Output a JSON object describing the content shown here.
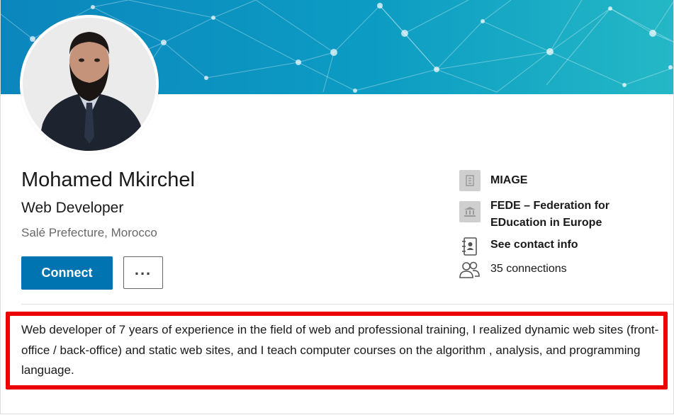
{
  "profile": {
    "name": "Mohamed Mkirchel",
    "headline": "Web Developer",
    "location": "Salé Prefecture, Morocco",
    "connect_label": "Connect",
    "more_label": "..."
  },
  "info": {
    "company": "MIAGE",
    "school": "FEDE – Federation for EDucation in Europe",
    "contact": "See contact info",
    "connections": "35 connections"
  },
  "summary": "Web developer of 7 years of experience in the field of web and professional training, I realized dynamic web sites (front-office / back-office) and static web sites, and I teach computer courses on the algorithm , analysis, and programming language.",
  "colors": {
    "primary": "#0073b1",
    "highlight_border": "#ee0000",
    "banner_start": "#0e8fc0",
    "banner_end": "#21b7c4"
  },
  "icons": [
    "company-icon",
    "school-icon",
    "contact-book-icon",
    "connections-icon",
    "more-dots-icon"
  ]
}
